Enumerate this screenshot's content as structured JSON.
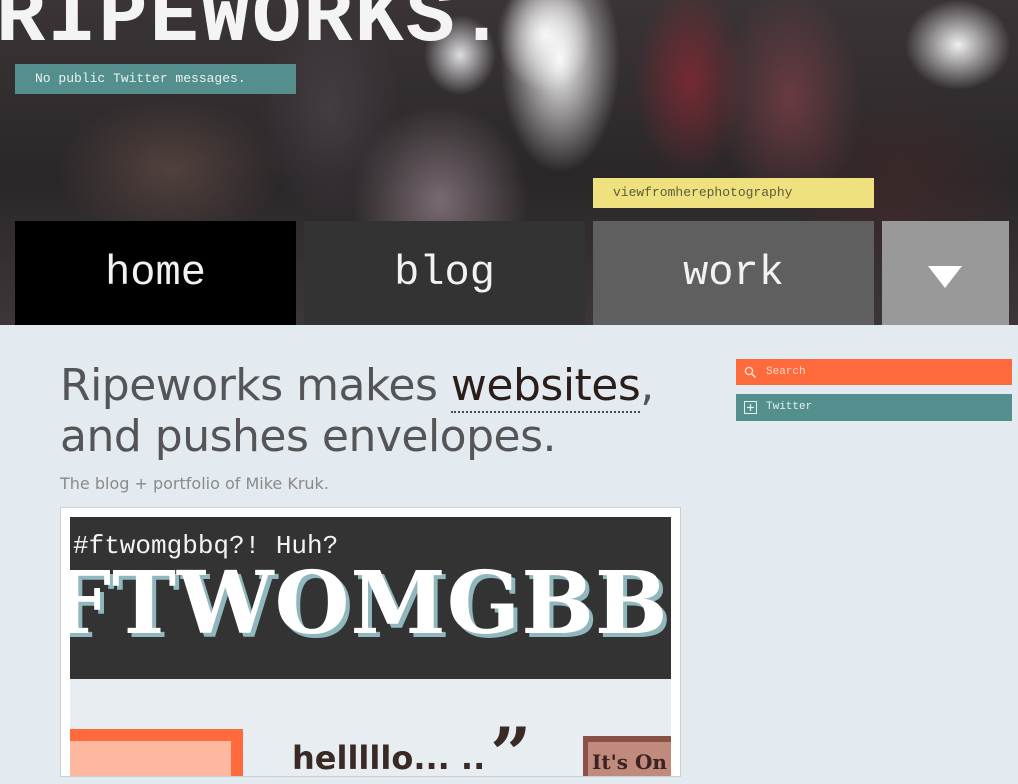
{
  "site": {
    "logo": "RIPEWORKS.",
    "tweet": "No public Twitter messages.",
    "photo_credit": "viewfromherephotography"
  },
  "nav": {
    "home": "home",
    "blog": "blog",
    "work": "work"
  },
  "main": {
    "headline_pre": "Ripeworks makes ",
    "headline_link": "websites",
    "headline_post": ", and pushes envelopes.",
    "tagline": "The blog + portfolio of Mike Kruk.",
    "feature": {
      "hashtag": "#ftwomgbbq?! Huh?",
      "big_text": "FTWOMGBBQ",
      "hello_text": "helllllo... ..",
      "quote_mark": "”",
      "its_on": "It's On"
    }
  },
  "sidebar": {
    "search_placeholder": "Search",
    "twitter_label": "Twitter"
  },
  "colors": {
    "teal": "#548f8e",
    "orange": "#ff6a3d",
    "yellow": "#efe27e",
    "page_bg": "#e3ebf0"
  }
}
